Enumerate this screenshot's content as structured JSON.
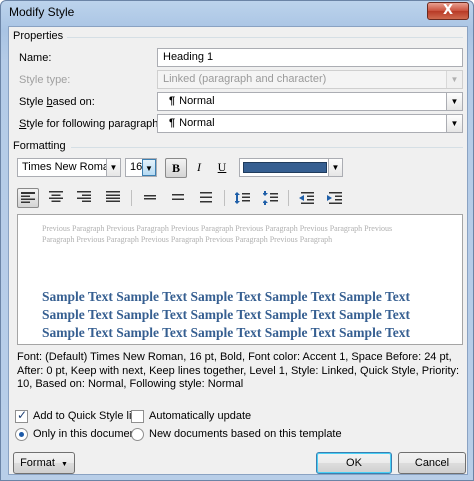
{
  "window": {
    "title": "Modify Style",
    "close_glyph": "X"
  },
  "properties": {
    "group_label": "Properties",
    "name_label": "Name:",
    "name_value": "Heading 1",
    "style_type_label": "Style type:",
    "style_type_value": "Linked (paragraph and character)",
    "based_on_label_pre": "Style ",
    "based_on_label_ul": "b",
    "based_on_label_post": "ased on:",
    "based_on_value": "Normal",
    "following_label_pre": "",
    "following_label_ul": "S",
    "following_label_post": "tyle for following paragraph:",
    "following_value": "Normal",
    "pilcrow": "¶"
  },
  "formatting": {
    "group_label": "Formatting",
    "font_value": "Times New Roman",
    "size_value": "16",
    "bold": "B",
    "italic": "I",
    "underline": "U",
    "font_color": "#365f91"
  },
  "preview": {
    "previous_paragraph_line1": "Previous Paragraph Previous Paragraph Previous Paragraph Previous Paragraph Previous Paragraph Previous",
    "previous_paragraph_line2": "Paragraph Previous Paragraph Previous Paragraph Previous Paragraph Previous Paragraph",
    "sample_text": "Sample Text Sample Text Sample Text Sample Text Sample Text Sample Text Sample Text Sample Text Sample Text Sample Text Sample Text Sample Text Sample Text Sample Text Sample Text Sample Text Sample Text Sample Text Sample Text Sample Text Sample Text"
  },
  "description": "Font: (Default) Times New Roman, 16 pt, Bold, Font color: Accent 1, Space Before:  24 pt, After:  0 pt, Keep with next, Keep lines together, Level 1, Style: Linked, Quick Style, Priority: 10, Based on: Normal, Following style: Normal",
  "options": {
    "add_quick_style": "Add to Quick Style list",
    "auto_update": "Automatically update",
    "only_this_doc": "Only in this document",
    "new_docs": "New documents based on this template"
  },
  "buttons": {
    "format": "Format",
    "format_arrow": "▼",
    "ok": "OK",
    "cancel": "Cancel"
  }
}
